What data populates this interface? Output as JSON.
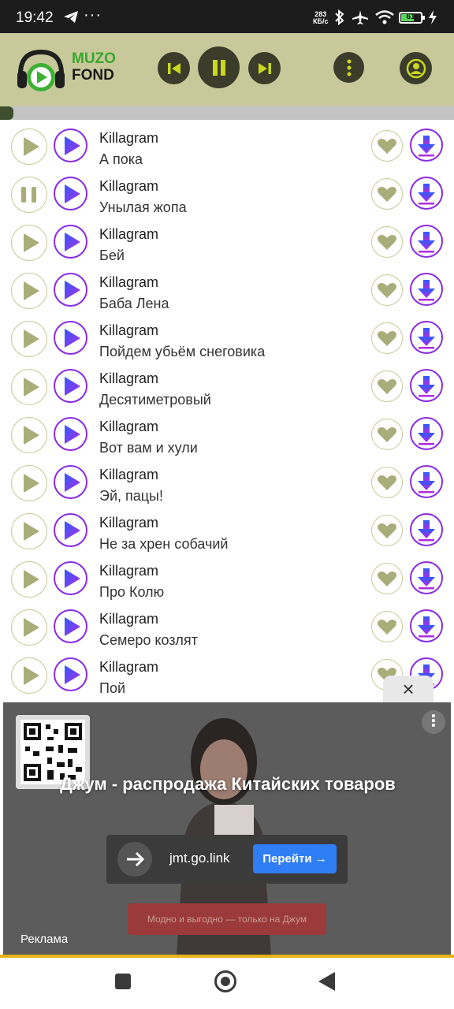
{
  "status_bar": {
    "time": "19:42",
    "dots": "···",
    "speed_value": "283",
    "speed_unit": "КБ/с",
    "battery": "61"
  },
  "header": {
    "logo_line1": "MUZO",
    "logo_line2": "FOND",
    "progress_fraction": 0.03,
    "colors": {
      "bg": "#c7c99b",
      "buttons": "#3b3c2a",
      "accent": "#c9d81e"
    }
  },
  "tracks": [
    {
      "artist": "Killagram",
      "title": "А пока",
      "playing": false
    },
    {
      "artist": "Killagram",
      "title": "Унылая жопа",
      "playing": true
    },
    {
      "artist": "Killagram",
      "title": "Бей",
      "playing": false
    },
    {
      "artist": "Killagram",
      "title": "Баба Лена",
      "playing": false
    },
    {
      "artist": "Killagram",
      "title": "Пойдем убьём снеговика",
      "playing": false
    },
    {
      "artist": "Killagram",
      "title": "Десятиметровый",
      "playing": false
    },
    {
      "artist": "Killagram",
      "title": "Вот вам и хули",
      "playing": false
    },
    {
      "artist": "Killagram",
      "title": "Эй, пацы!",
      "playing": false
    },
    {
      "artist": "Killagram",
      "title": "Не за хрен собачий",
      "playing": false
    },
    {
      "artist": "Killagram",
      "title": "Про Колю",
      "playing": false
    },
    {
      "artist": "Killagram",
      "title": "Семеро козлят",
      "playing": false
    },
    {
      "artist": "Killagram",
      "title": "Пой",
      "playing": false
    }
  ],
  "ad": {
    "close": "×",
    "headline": "Джум - распродажа Китайских товаров",
    "domain": "jmt.go.link",
    "cta": "Перейти →",
    "sub_button": "Модно и выгодно — только на Джум",
    "label": "Реклама"
  }
}
